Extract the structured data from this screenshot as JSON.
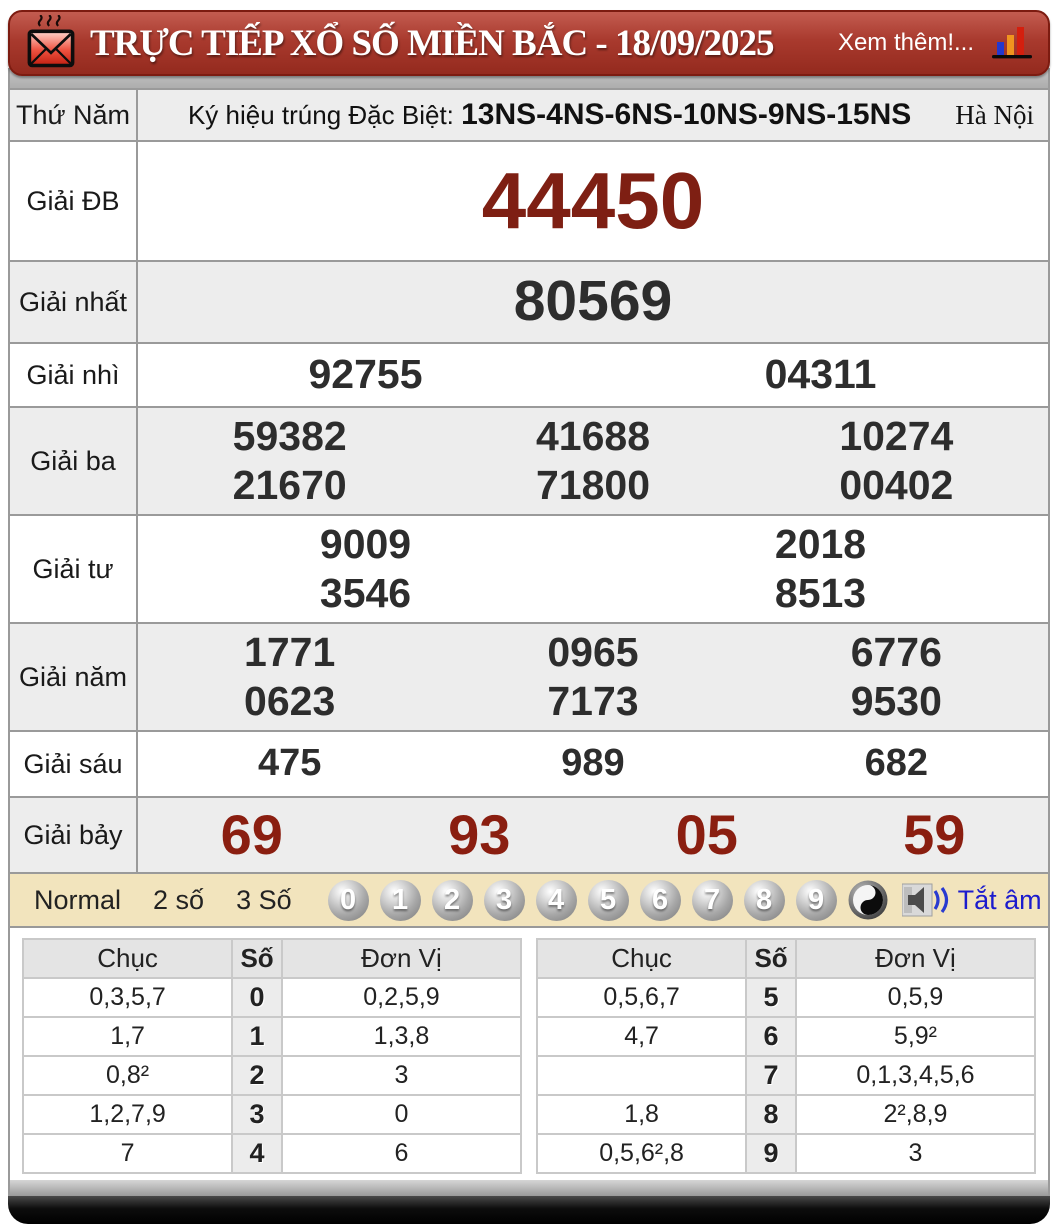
{
  "header": {
    "title": "TRỰC TIẾP XỔ SỐ MIỀN BẮC - 18/09/2025",
    "more_link": "Xem thêm!...",
    "envelope_icon": "envelope-icon",
    "chart_icon": "chart-icon"
  },
  "results": {
    "day_label": "Thứ Năm",
    "special_sign_label": "Ký hiệu trúng Đặc Biệt:",
    "special_sign_value": "13NS-4NS-6NS-10NS-9NS-15NS",
    "province": "Hà Nội",
    "rows": [
      {
        "label": "Giải ĐB",
        "numbers": [
          [
            "44450"
          ]
        ]
      },
      {
        "label": "Giải nhất",
        "numbers": [
          [
            "80569"
          ]
        ]
      },
      {
        "label": "Giải nhì",
        "numbers": [
          [
            "92755",
            "04311"
          ]
        ]
      },
      {
        "label": "Giải ba",
        "numbers": [
          [
            "59382",
            "41688",
            "10274"
          ],
          [
            "21670",
            "71800",
            "00402"
          ]
        ]
      },
      {
        "label": "Giải tư",
        "numbers": [
          [
            "9009",
            "2018"
          ],
          [
            "3546",
            "8513"
          ]
        ]
      },
      {
        "label": "Giải năm",
        "numbers": [
          [
            "1771",
            "0965",
            "6776"
          ],
          [
            "0623",
            "7173",
            "9530"
          ]
        ]
      },
      {
        "label": "Giải sáu",
        "numbers": [
          [
            "475",
            "989",
            "682"
          ]
        ]
      },
      {
        "label": "Giải bảy",
        "numbers": [
          [
            "69",
            "93",
            "05",
            "59"
          ]
        ]
      }
    ]
  },
  "controls": {
    "modes": [
      "Normal",
      "2 số",
      "3 Số"
    ],
    "balls": [
      "0",
      "1",
      "2",
      "3",
      "4",
      "5",
      "6",
      "7",
      "8",
      "9"
    ],
    "yin_yang_icon": "yin-yang-icon",
    "speaker_icon": "speaker-icon",
    "mute_label": "Tắt âm"
  },
  "loto": {
    "headers": {
      "chuc": "Chục",
      "so": "Số",
      "donvi": "Đơn Vị"
    },
    "left": [
      {
        "chuc": "0,3,5,7",
        "so": "0",
        "donvi": "0,2,5,9"
      },
      {
        "chuc": "1,7",
        "so": "1",
        "donvi": "1,3,8"
      },
      {
        "chuc": "0,8²",
        "so": "2",
        "donvi": "3"
      },
      {
        "chuc": "1,2,7,9",
        "so": "3",
        "donvi": "0"
      },
      {
        "chuc": "7",
        "so": "4",
        "donvi": "6"
      }
    ],
    "right": [
      {
        "chuc": "0,5,6,7",
        "so": "5",
        "donvi": "0,5,9"
      },
      {
        "chuc": "4,7",
        "so": "6",
        "donvi": "5,9²"
      },
      {
        "chuc": "",
        "so": "7",
        "donvi": "0,1,3,4,5,6"
      },
      {
        "chuc": "1,8",
        "so": "8",
        "donvi": "2²,8,9"
      },
      {
        "chuc": "0,5,6²,8",
        "so": "9",
        "donvi": "3"
      }
    ]
  },
  "colors": {
    "header_red": "#a93a2e",
    "header_border": "#7c1b10",
    "special_number_red": "#7e1f13",
    "seventh_prize_red": "#8a1e10",
    "control_bar_cream": "#f2e4bd",
    "mute_blue": "#1c1ccd",
    "row_alt_gray": "#ededed"
  }
}
